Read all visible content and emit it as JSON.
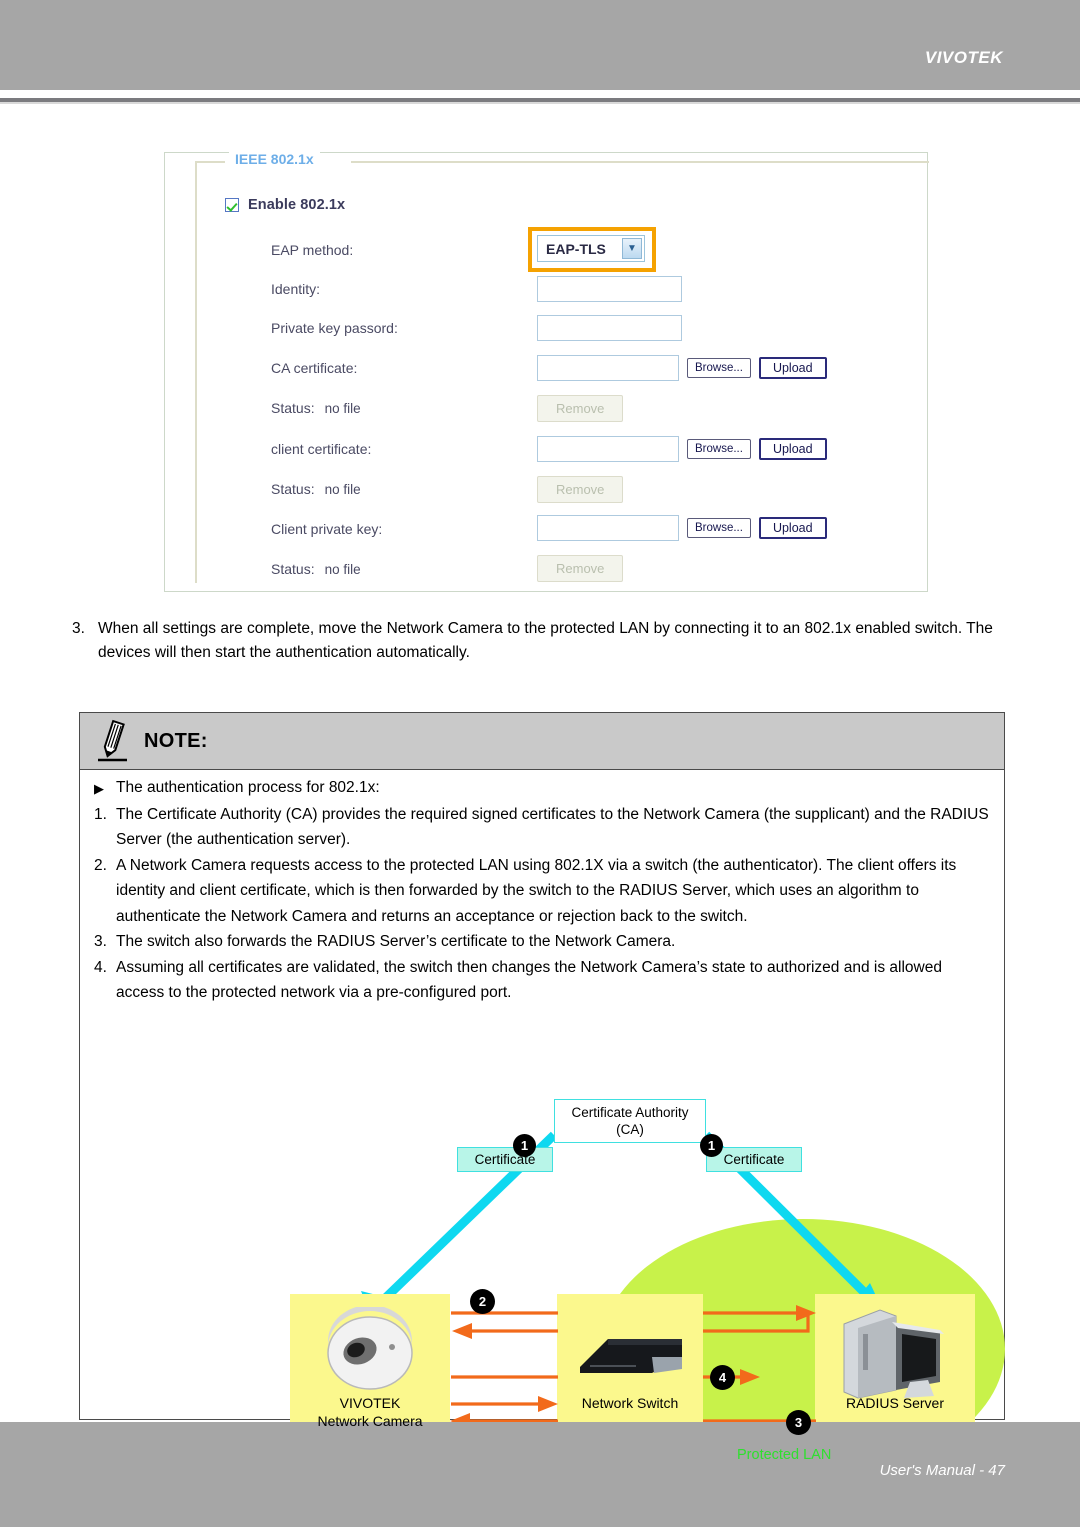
{
  "header": {
    "brand": "VIVOTEK"
  },
  "footer": {
    "text": "User's Manual - 47"
  },
  "panel": {
    "legend": "IEEE 802.1x",
    "enable_label": "Enable 802.1x",
    "rows": {
      "eap_method_label": "EAP method:",
      "eap_method_value": "EAP-TLS",
      "identity_label": "Identity:",
      "identity_value": "",
      "private_key_label": "Private key passord:",
      "private_key_value": "",
      "ca_cert_label": "CA certificate:",
      "ca_cert_value": "",
      "ca_status_label": "Status:",
      "ca_status_value": "no file",
      "client_cert_label": "client certificate:",
      "client_cert_value": "",
      "client_status_label": "Status:",
      "client_status_value": "no file",
      "client_key_label": "Client private key:",
      "client_key_value": "",
      "key_status_label": "Status:",
      "key_status_value": "no file"
    },
    "buttons": {
      "browse": "Browse...",
      "upload": "Upload",
      "remove": "Remove"
    },
    "colors": {
      "legend": "#6daee8",
      "highlight": "#f5a201",
      "panel_border": "#cdd8c9"
    }
  },
  "step3": {
    "number": "3.",
    "text": "When all settings are complete, move the Network Camera to the protected LAN by connecting it to an 802.1x enabled switch. The devices will then start the authentication automatically."
  },
  "note": {
    "title": "NOTE:",
    "bullet_mark": "▶",
    "bullet_text": "The authentication process for 802.1x:",
    "items": [
      {
        "num": "1.",
        "text": "The Certificate Authority (CA) provides the required signed certificates to the Network Camera (the supplicant) and the RADIUS Server (the authentication server)."
      },
      {
        "num": "2.",
        "text": "A Network Camera requests access to the protected LAN using 802.1X via a switch (the authenticator).  The client offers its identity and client certificate, which is then forwarded by the switch to the RADIUS Server, which uses an algorithm to authenticate the Network Camera and returns an acceptance or rejection back to the switch."
      },
      {
        "num": "3.",
        "text": "The switch also forwards the RADIUS Server’s certificate to the Network Camera."
      },
      {
        "num": "4.",
        "text": "Assuming all certificates are validated, the switch then changes the Network Camera’s state to authorized and is allowed access to the protected network via a pre-configured port."
      }
    ]
  },
  "diagram": {
    "ca_title_line1": "Certificate Authority",
    "ca_title_line2": "(CA)",
    "cert_left": "Certificate",
    "cert_right": "Certificate",
    "badge_1a": "1",
    "badge_1b": "1",
    "badge_2": "2",
    "badge_3": "3",
    "badge_4": "4",
    "camera_line1": "VIVOTEK",
    "camera_line2": "Network Camera",
    "switch_label": "Network Switch",
    "radius_label": "RADIUS Server",
    "lan_label": "Protected LAN",
    "colors": {
      "cyan": "#0ed8f0",
      "orange": "#f26a1b",
      "yellow": "#fbf88d",
      "green_lan": "#c8f24a",
      "lan_text": "#2ee02e",
      "cert_fill": "#b8f5e8"
    }
  }
}
